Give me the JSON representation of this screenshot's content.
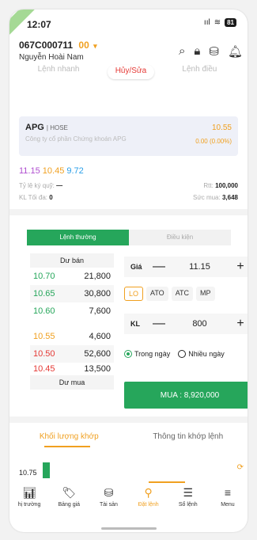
{
  "status": {
    "time": "12:07",
    "battery": "81"
  },
  "account": {
    "id": "067C000711",
    "sub": "00",
    "name": "Nguyễn Hoài Nam"
  },
  "order_type_tabs": [
    "Lệnh nhanh",
    "Hủy/Sửa",
    "Lệnh điều"
  ],
  "stock": {
    "symbol": "APG",
    "exchange": "| HOSE",
    "company": "Công ty cổ phần Chứng khoán APG",
    "price": "10.55",
    "change": "0.00 (0.00%)"
  },
  "price_levels": {
    "ceil": "11.15",
    "ref": "10.45",
    "floor": "9.72"
  },
  "margin": {
    "label": "Tỷ lệ ký quỹ:",
    "value": "—",
    "rtt_label": "Rtt:",
    "rtt_value": "100,000"
  },
  "max_qty": {
    "label": "KL Tối đa:",
    "value": "0",
    "power_label": "Sức mua:",
    "power_value": "3,648"
  },
  "main_tabs": [
    "Lệnh thường",
    "Điều kiện"
  ],
  "orderbook": {
    "sell_label": "Dư bán",
    "buy_label": "Dư mua",
    "sell": [
      {
        "price": "10.70",
        "qty": "21,800"
      },
      {
        "price": "10.65",
        "qty": "30,800"
      },
      {
        "price": "10.60",
        "qty": "7,600"
      }
    ],
    "buy": [
      {
        "price": "10.55",
        "qty": "4,600"
      },
      {
        "price": "10.50",
        "qty": "52,600"
      },
      {
        "price": "10.45",
        "qty": "13,500"
      }
    ]
  },
  "form": {
    "price_label": "Giá",
    "price_value": "11.15",
    "qty_label": "KL",
    "qty_value": "800",
    "order_types": [
      "LO",
      "ATO",
      "ATC",
      "MP"
    ],
    "radio_today": "Trong ngày",
    "radio_multi": "Nhiều ngày",
    "buy_button": "MUA : 8,920,000"
  },
  "match_tabs": [
    "Khối lượng khớp",
    "Thông tin khớp lệnh"
  ],
  "chart_price": "10.75",
  "nav": [
    "hị trường",
    "Bảng giá",
    "Tài sản",
    "Đặt lệnh",
    "Sổ lệnh",
    "Menu"
  ],
  "colors": {
    "green": "#26a65b",
    "orange": "#f0a020",
    "red": "#e53935"
  }
}
